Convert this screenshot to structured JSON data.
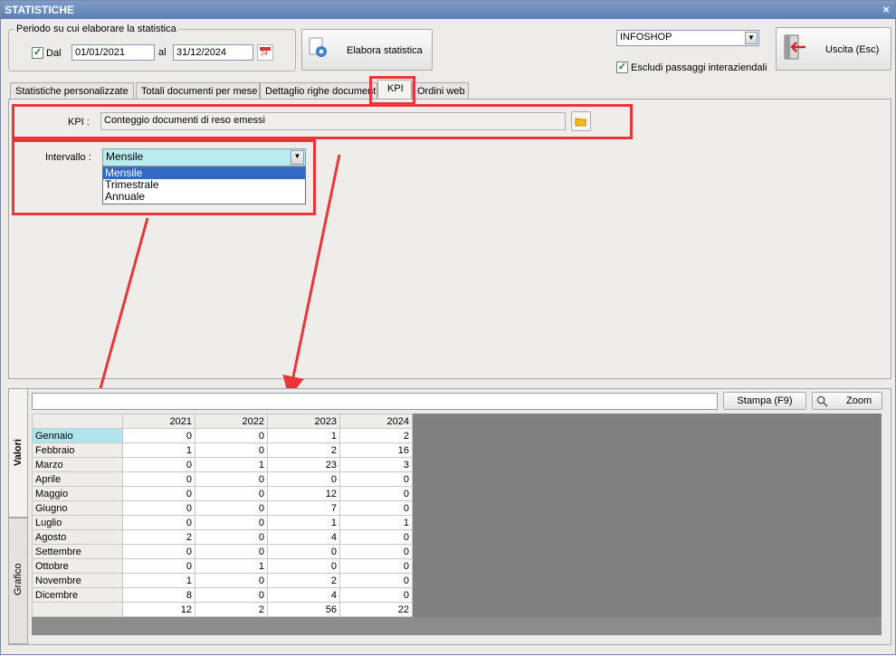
{
  "window": {
    "title": "STATISTICHE",
    "close_label": "×"
  },
  "period": {
    "title": "Periodo su cui elaborare la statistica",
    "dal_label": "Dal",
    "dal_checked": true,
    "from_date": "01/01/2021",
    "al_label": "al",
    "to_date": "31/12/2024",
    "calendar_day": "24"
  },
  "buttons": {
    "elabora": "Elabora statistica",
    "uscita": "Uscita (Esc)",
    "stampa": "Stampa (F9)",
    "zoom": "Zoom"
  },
  "shop_select": {
    "value": "INFOSHOP"
  },
  "escludi": {
    "label": "Escludi passaggi interaziendali",
    "checked": true
  },
  "tabs": [
    {
      "label": "Statistiche personalizzate"
    },
    {
      "label": "Totali documenti per mese"
    },
    {
      "label": "Dettaglio righe documenti"
    },
    {
      "label": "KPI"
    },
    {
      "label": "Ordini web"
    }
  ],
  "kpi": {
    "label": "KPI :",
    "value": "Conteggio documenti di reso emessi"
  },
  "intervallo": {
    "label": "Intervallo :",
    "value": "Mensile",
    "options": [
      "Mensile",
      "Trimestrale",
      "Annuale"
    ]
  },
  "filter_value": "",
  "side_tabs": {
    "valori": "Valori",
    "grafico": "Grafico"
  },
  "table": {
    "columns": [
      "2021",
      "2022",
      "2023",
      "2024"
    ],
    "rows": [
      {
        "month": "Gennaio",
        "v": [
          0,
          0,
          1,
          2
        ]
      },
      {
        "month": "Febbraio",
        "v": [
          1,
          0,
          2,
          16
        ]
      },
      {
        "month": "Marzo",
        "v": [
          0,
          1,
          23,
          3
        ]
      },
      {
        "month": "Aprile",
        "v": [
          0,
          0,
          0,
          0
        ]
      },
      {
        "month": "Maggio",
        "v": [
          0,
          0,
          12,
          0
        ]
      },
      {
        "month": "Giugno",
        "v": [
          0,
          0,
          7,
          0
        ]
      },
      {
        "month": "Luglio",
        "v": [
          0,
          0,
          1,
          1
        ]
      },
      {
        "month": "Agosto",
        "v": [
          2,
          0,
          4,
          0
        ]
      },
      {
        "month": "Settembre",
        "v": [
          0,
          0,
          0,
          0
        ]
      },
      {
        "month": "Ottobre",
        "v": [
          0,
          1,
          0,
          0
        ]
      },
      {
        "month": "Novembre",
        "v": [
          1,
          0,
          2,
          0
        ]
      },
      {
        "month": "Dicembre",
        "v": [
          8,
          0,
          4,
          0
        ]
      }
    ],
    "totals": [
      12,
      2,
      56,
      22
    ]
  }
}
